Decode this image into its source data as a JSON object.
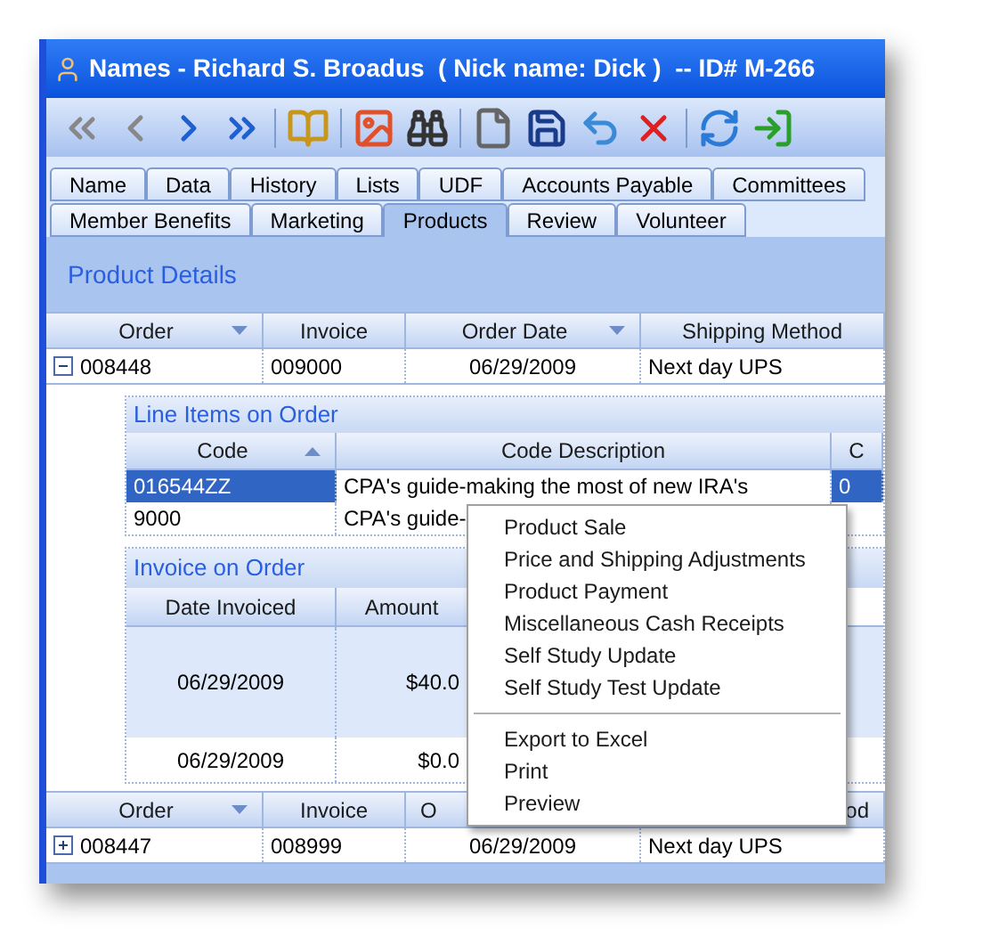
{
  "window": {
    "title": "Names - Richard S. Broadus  ( Nick name: Dick )  -- ID# M-266"
  },
  "tab_rows": [
    [
      {
        "label": "Name",
        "selected": false
      },
      {
        "label": "Data",
        "selected": false
      },
      {
        "label": "History",
        "selected": false
      },
      {
        "label": "Lists",
        "selected": false
      },
      {
        "label": "UDF",
        "selected": false
      },
      {
        "label": "Accounts Payable",
        "selected": false
      },
      {
        "label": "Committees",
        "selected": false
      }
    ],
    [
      {
        "label": "Member Benefits",
        "selected": false
      },
      {
        "label": "Marketing",
        "selected": false
      },
      {
        "label": "Products",
        "selected": true
      },
      {
        "label": "Review",
        "selected": false
      },
      {
        "label": "Volunteer",
        "selected": false
      }
    ]
  ],
  "section_title": "Product Details",
  "orders": {
    "columns": [
      {
        "label": "Order",
        "filter": true
      },
      {
        "label": "Invoice",
        "filter": false
      },
      {
        "label": "Order Date",
        "filter": true
      },
      {
        "label": "Shipping Method",
        "filter": false
      }
    ],
    "rows": [
      {
        "expanded": true,
        "cells": [
          "008448",
          "009000",
          "06/29/2009",
          "Next day UPS"
        ]
      }
    ]
  },
  "line_items": {
    "title": "Line Items on Order",
    "columns": [
      {
        "label": "Code",
        "sorted_ascending": true
      },
      {
        "label": "Code Description",
        "sorted_ascending": false
      },
      {
        "label": "C",
        "sorted_ascending": false
      }
    ],
    "rows": [
      {
        "selected": true,
        "cells": [
          "016544ZZ",
          "CPA's guide-making the most of new IRA's",
          "0"
        ]
      },
      {
        "selected": false,
        "cells": [
          "9000",
          "CPA's guide-"
        ]
      }
    ]
  },
  "invoice": {
    "title": "Invoice on Order",
    "columns": [
      {
        "label": "Date Invoiced"
      },
      {
        "label": "Amount"
      }
    ],
    "rows": [
      {
        "selected": true,
        "cells": [
          "06/29/2009",
          "$40.0"
        ]
      },
      {
        "selected": false,
        "cells": [
          "06/29/2009",
          "$0.0"
        ]
      }
    ]
  },
  "orders_bottom": {
    "columns": [
      {
        "label": "Order",
        "filter": true
      },
      {
        "label": "Invoice",
        "filter": false
      },
      {
        "label": "O",
        "filter": false
      },
      {
        "label": "od",
        "filter": false
      }
    ],
    "rows": [
      {
        "expanded": false,
        "cells": [
          "008447",
          "008999",
          "06/29/2009",
          "Next day UPS"
        ]
      }
    ]
  },
  "context_menu": [
    {
      "kind": "item",
      "label": "Product Sale"
    },
    {
      "kind": "item",
      "label": "Price and Shipping Adjustments"
    },
    {
      "kind": "item",
      "label": "Product Payment"
    },
    {
      "kind": "item",
      "label": "Miscellaneous Cash Receipts"
    },
    {
      "kind": "item",
      "label": "Self Study Update"
    },
    {
      "kind": "item",
      "label": "Self Study Test Update"
    },
    {
      "kind": "separator"
    },
    {
      "kind": "item",
      "label": "Export to Excel"
    },
    {
      "kind": "item",
      "label": "Print"
    },
    {
      "kind": "item",
      "label": "Preview"
    }
  ]
}
